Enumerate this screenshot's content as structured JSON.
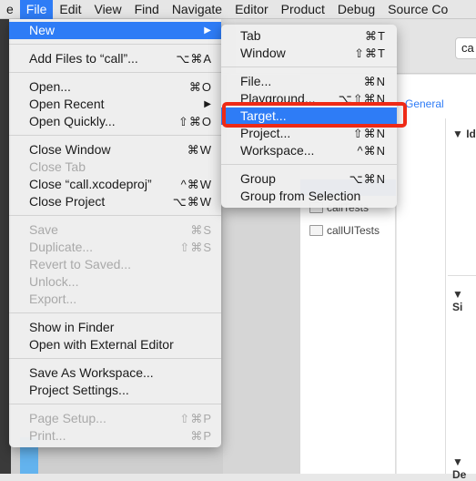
{
  "menubar": {
    "items": [
      "e",
      "File",
      "Edit",
      "View",
      "Find",
      "Navigate",
      "Editor",
      "Product",
      "Debug",
      "Source Co"
    ],
    "active": 1
  },
  "file_menu": [
    {
      "label": "New",
      "shortcut": "▶",
      "highlighted": true
    },
    {
      "sep": true
    },
    {
      "label": "Add Files to “call”...",
      "shortcut": "⌥⌘A"
    },
    {
      "sep": true
    },
    {
      "label": "Open...",
      "shortcut": "⌘O"
    },
    {
      "label": "Open Recent",
      "shortcut": "▶"
    },
    {
      "label": "Open Quickly...",
      "shortcut": "⇧⌘O"
    },
    {
      "sep": true
    },
    {
      "label": "Close Window",
      "shortcut": "⌘W"
    },
    {
      "label": "Close Tab",
      "shortcut": "",
      "disabled": true
    },
    {
      "label": "Close “call.xcodeproj”",
      "shortcut": "^⌘W"
    },
    {
      "label": "Close Project",
      "shortcut": "⌥⌘W"
    },
    {
      "sep": true
    },
    {
      "label": "Save",
      "shortcut": "⌘S",
      "disabled": true
    },
    {
      "label": "Duplicate...",
      "shortcut": "⇧⌘S",
      "disabled": true
    },
    {
      "label": "Revert to Saved...",
      "shortcut": "",
      "disabled": true
    },
    {
      "label": "Unlock...",
      "shortcut": "",
      "disabled": true
    },
    {
      "label": "Export...",
      "shortcut": "",
      "disabled": true
    },
    {
      "sep": true
    },
    {
      "label": "Show in Finder",
      "shortcut": ""
    },
    {
      "label": "Open with External Editor",
      "shortcut": ""
    },
    {
      "sep": true
    },
    {
      "label": "Save As Workspace...",
      "shortcut": ""
    },
    {
      "label": "Project Settings...",
      "shortcut": ""
    },
    {
      "sep": true
    },
    {
      "label": "Page Setup...",
      "shortcut": "⇧⌘P",
      "disabled": true
    },
    {
      "label": "Print...",
      "shortcut": "⌘P",
      "disabled": true
    }
  ],
  "new_submenu": [
    {
      "label": "Tab",
      "shortcut": "⌘T"
    },
    {
      "label": "Window",
      "shortcut": "⇧⌘T"
    },
    {
      "sep": true
    },
    {
      "label": "File...",
      "shortcut": "⌘N"
    },
    {
      "label": "Playground...",
      "shortcut": "⌥⇧⌘N"
    },
    {
      "label": "Target...",
      "shortcut": "",
      "highlighted": true
    },
    {
      "label": "Project...",
      "shortcut": "⇧⌘N"
    },
    {
      "label": "Workspace...",
      "shortcut": "^⌘N"
    },
    {
      "sep": true
    },
    {
      "label": "Group",
      "shortcut": "⌥⌘N"
    },
    {
      "label": "Group from Selection",
      "shortcut": ""
    }
  ],
  "xcode": {
    "scheme_button": "ca",
    "tab_general": "General",
    "navigator": [
      "callTests",
      "callUITests"
    ],
    "inspector_sections": [
      "Id",
      "Si",
      "De"
    ]
  },
  "colors": {
    "highlight": "#2e7cf6",
    "annotation": "#ee2a16"
  }
}
